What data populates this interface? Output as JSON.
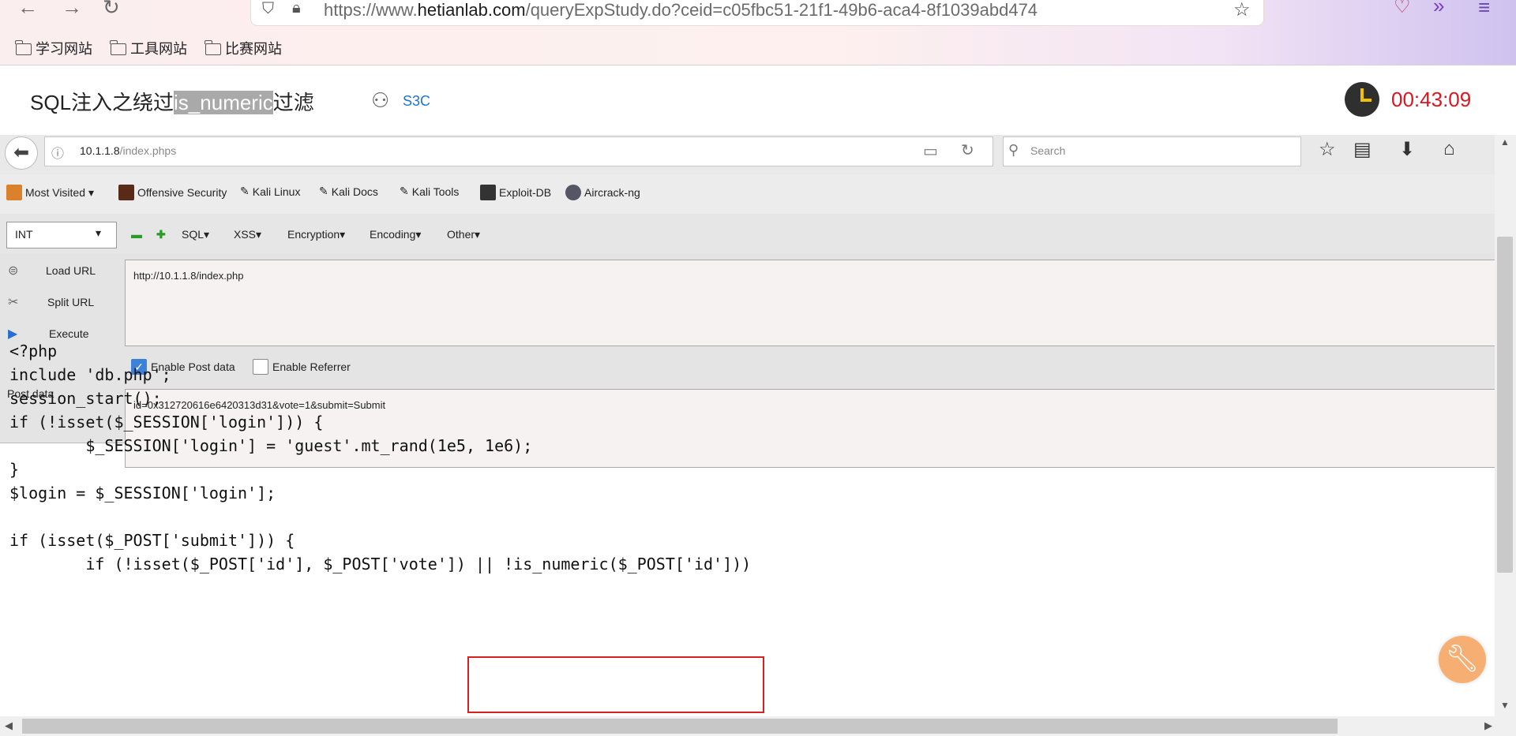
{
  "browser": {
    "url_prefix": "https://www.",
    "url_domain": "hetianlab.com",
    "url_path": "/queryExpStudy.do?ceid=c05fbc51-21f1-49b6-aca4-8f1039abd474",
    "bookmarks": [
      "学习网站",
      "工具网站",
      "比赛网站"
    ]
  },
  "lab": {
    "title_pre": "SQL注入之绕过",
    "title_highlight": "is_numeric",
    "title_post": "过滤",
    "user": "S3C",
    "timer": "00:43:09"
  },
  "inner_browser": {
    "url_host": "10.1.1.8",
    "url_path": "/index.phps",
    "search_placeholder": "Search",
    "bookmarks": [
      "Most Visited",
      "Offensive Security",
      "Kali Linux",
      "Kali Docs",
      "Kali Tools",
      "Exploit-DB",
      "Aircrack-ng"
    ]
  },
  "hackbar": {
    "type_select": "INT",
    "menus": [
      "SQL",
      "XSS",
      "Encryption",
      "Encoding",
      "Other"
    ],
    "load_url": "Load URL",
    "split_url": "Split URL",
    "execute": "Execute",
    "url_value": "http://10.1.1.8/index.php",
    "enable_post": "Enable Post data",
    "enable_referrer": "Enable Referrer",
    "post_label": "Post data",
    "post_value": "id=0x312720616e6420313d31&vote=1&submit=Submit"
  },
  "code": "<?php\ninclude 'db.php';\nsession_start();\nif (!isset($_SESSION['login'])) {\n        $_SESSION['login'] = 'guest'.mt_rand(1e5, 1e6);\n}\n$login = $_SESSION['login'];\n\nif (isset($_POST['submit'])) {\n        if (!isset($_POST['id'], $_POST['vote']) || !is_numeric($_POST['id']))"
}
